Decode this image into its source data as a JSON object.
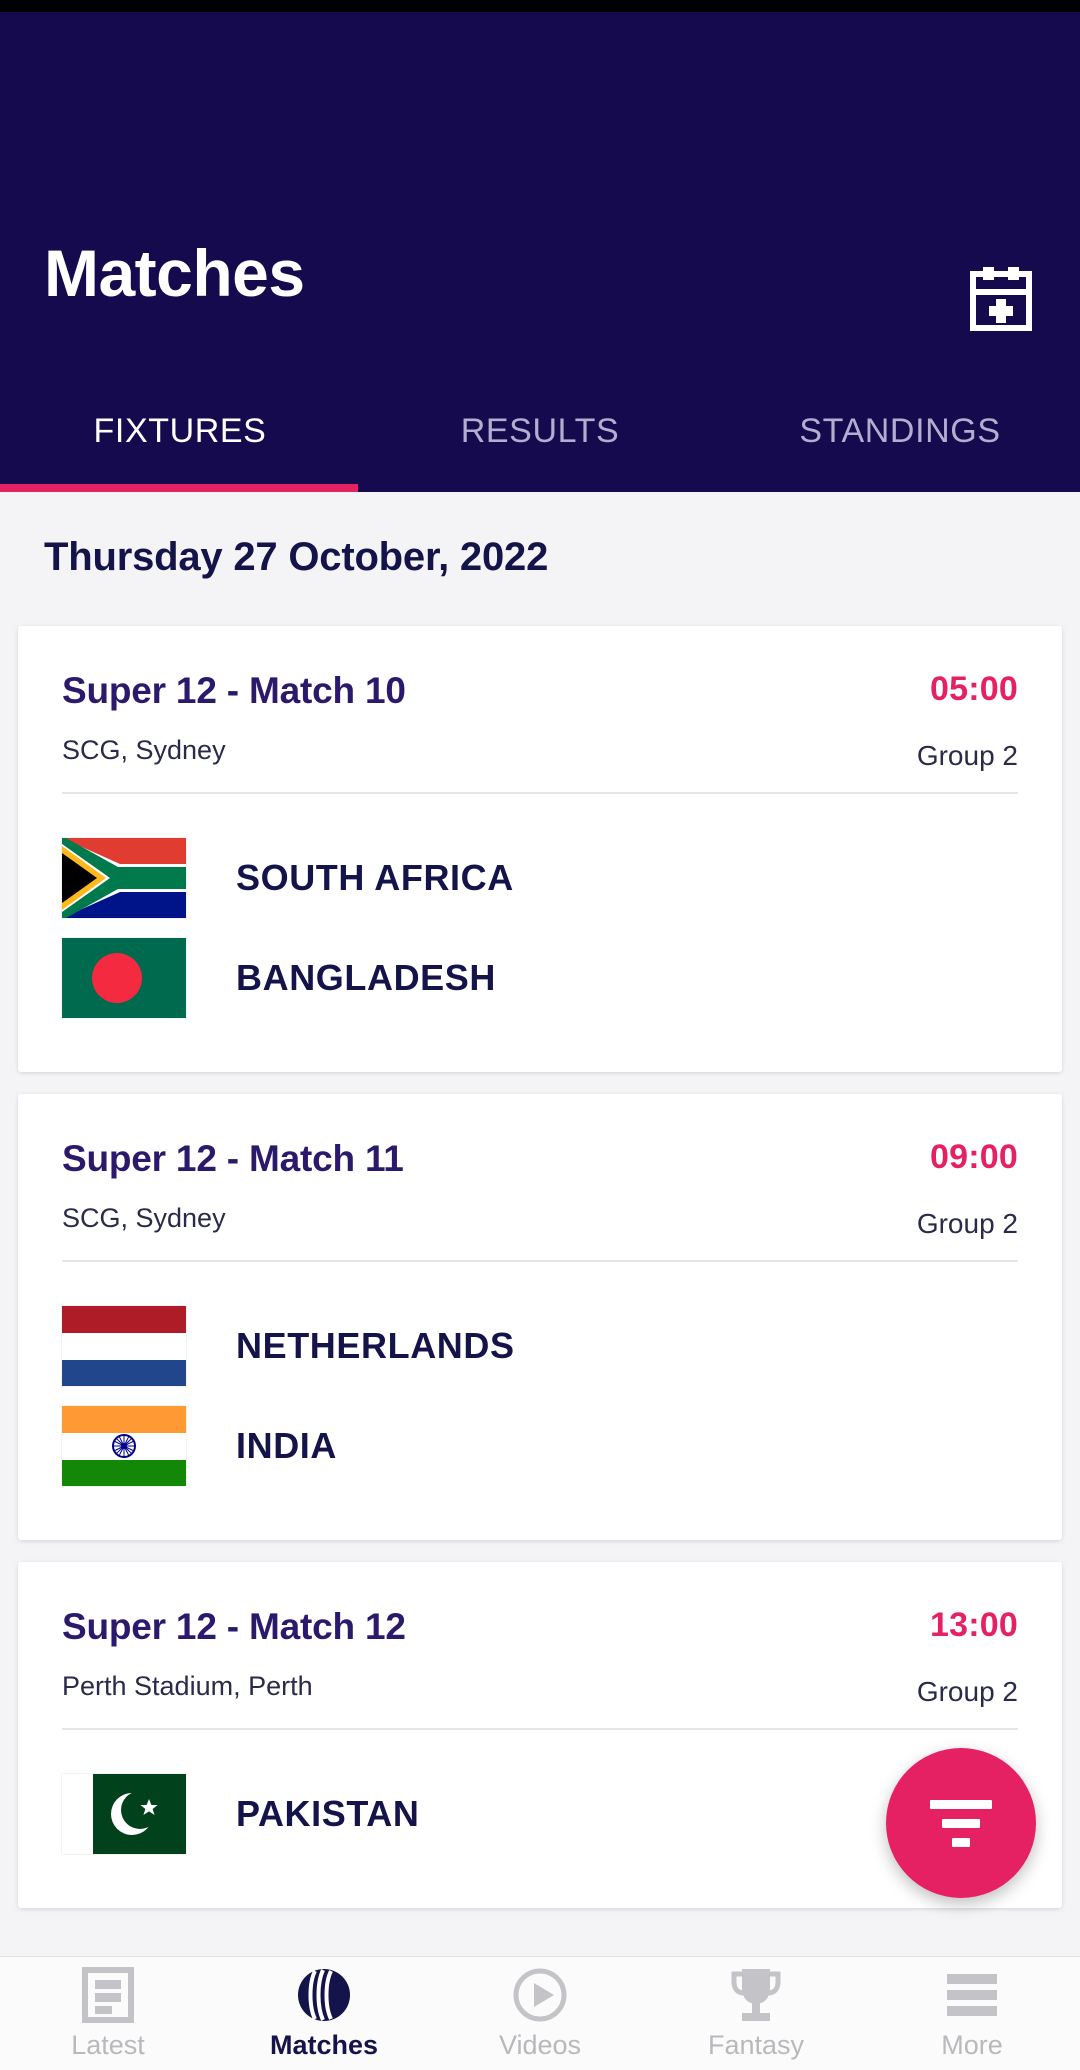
{
  "app": {
    "header_bg": "#150A4E",
    "accent": "#e62163",
    "navy": "#14134a"
  },
  "header": {
    "title": "Matches",
    "calendar_icon": "calendar-add-icon"
  },
  "tabs": [
    {
      "label": "FIXTURES",
      "active": true
    },
    {
      "label": "RESULTS",
      "active": false
    },
    {
      "label": "STANDINGS",
      "active": false
    }
  ],
  "fixtures": {
    "date_heading": "Thursday 27 October, 2022",
    "matches": [
      {
        "title": "Super 12 - Match 10",
        "venue": "SCG, Sydney",
        "time": "05:00",
        "group": "Group 2",
        "teams": [
          {
            "name": "SOUTH AFRICA",
            "flag": "flag-south-africa"
          },
          {
            "name": "BANGLADESH",
            "flag": "flag-bangladesh"
          }
        ]
      },
      {
        "title": "Super 12 - Match 11",
        "venue": "SCG, Sydney",
        "time": "09:00",
        "group": "Group 2",
        "teams": [
          {
            "name": "NETHERLANDS",
            "flag": "flag-netherlands"
          },
          {
            "name": "INDIA",
            "flag": "flag-india"
          }
        ]
      },
      {
        "title": "Super 12 - Match 12",
        "venue": "Perth Stadium, Perth",
        "time": "13:00",
        "group": "Group 2",
        "teams": [
          {
            "name": "PAKISTAN",
            "flag": "flag-pakistan"
          }
        ]
      }
    ]
  },
  "fab": {
    "icon": "filter-icon",
    "color": "#e62163"
  },
  "bottom_nav": [
    {
      "label": "Latest",
      "icon": "news-icon",
      "active": false
    },
    {
      "label": "Matches",
      "icon": "cricket-ball-icon",
      "active": true
    },
    {
      "label": "Videos",
      "icon": "play-circle-icon",
      "active": false
    },
    {
      "label": "Fantasy",
      "icon": "trophy-icon",
      "active": false
    },
    {
      "label": "More",
      "icon": "hamburger-icon",
      "active": false
    }
  ]
}
